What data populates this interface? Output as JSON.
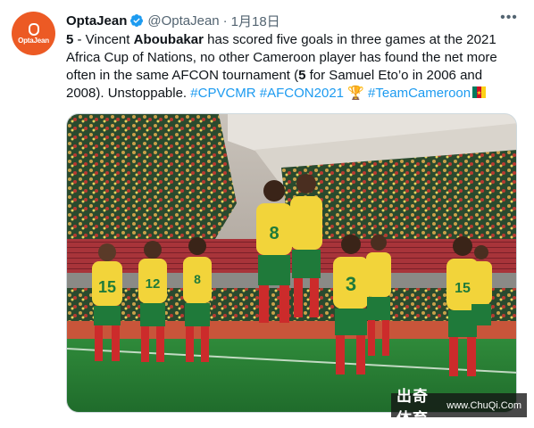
{
  "author": {
    "name": "OptaJean",
    "handle": "@OptaJean",
    "separator": "·",
    "date": "1月18日",
    "avatar_text": "OptaJean"
  },
  "tweet": {
    "number": "5",
    "t1": " - Vincent ",
    "bold_name": "Aboubakar",
    "t2": " has scored five goals in three games at the 2021 Africa Cup of Nations, no other Cameroon player has found the net more often in the same AFCON tournament (",
    "bold_five": "5",
    "t3": " for Samuel Eto’o in 2006 and 2008). Unstoppable. ",
    "tag1": "#CPVCMR",
    "tag2": "#AFCON2021",
    "trophy_emoji": "🏆",
    "tag3": "#TeamCameroon",
    "flag_icon": "cameroon-flag-icon"
  },
  "media": {
    "kit_numbers": [
      "15",
      "12",
      "8",
      "8",
      "3",
      "15"
    ]
  },
  "watermark": {
    "cn": "出奇体育",
    "url": "www.ChuQi.Com"
  },
  "colors": {
    "avatar_bg": "#ec5a24",
    "link": "#1d9bf0",
    "verified": "#1d9bf0",
    "muted": "#536471"
  }
}
